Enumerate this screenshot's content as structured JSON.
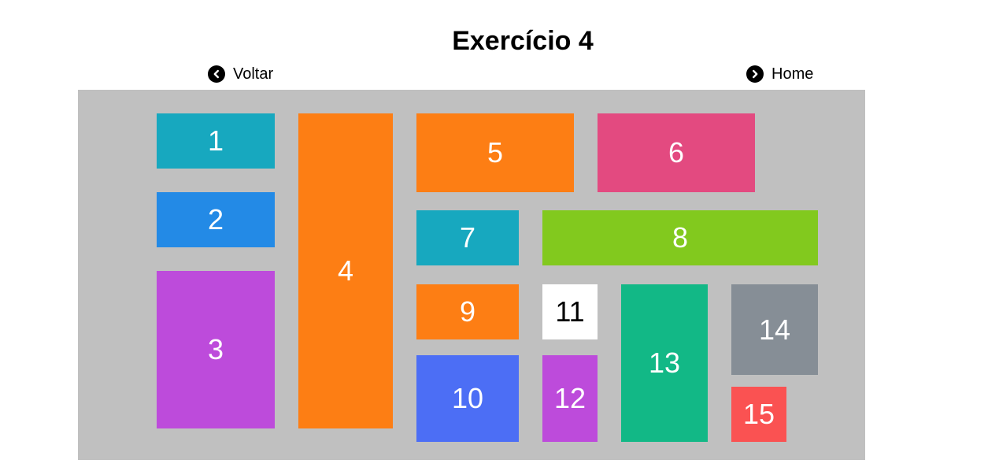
{
  "page": {
    "title": "Exercício 4"
  },
  "nav": {
    "back_label": "Voltar",
    "back_icon": "chevron-left-circle-icon",
    "home_label": "Home",
    "home_icon": "chevron-right-circle-icon"
  },
  "board": {
    "background": "#c0c0c0",
    "boxes": [
      {
        "label": "1",
        "color": "#17a8bf"
      },
      {
        "label": "2",
        "color": "#238ae6"
      },
      {
        "label": "3",
        "color": "#bd4bdb"
      },
      {
        "label": "4",
        "color": "#fd7e14"
      },
      {
        "label": "5",
        "color": "#fd7e14"
      },
      {
        "label": "6",
        "color": "#e34a80"
      },
      {
        "label": "7",
        "color": "#17a8bf"
      },
      {
        "label": "8",
        "color": "#82c91e"
      },
      {
        "label": "9",
        "color": "#fd7e14"
      },
      {
        "label": "10",
        "color": "#4c6ef5"
      },
      {
        "label": "11",
        "color": "#ffffff",
        "text_color": "#000000"
      },
      {
        "label": "12",
        "color": "#bd4bdb"
      },
      {
        "label": "13",
        "color": "#12b886"
      },
      {
        "label": "14",
        "color": "#868e96"
      },
      {
        "label": "15",
        "color": "#fa5252"
      }
    ]
  }
}
